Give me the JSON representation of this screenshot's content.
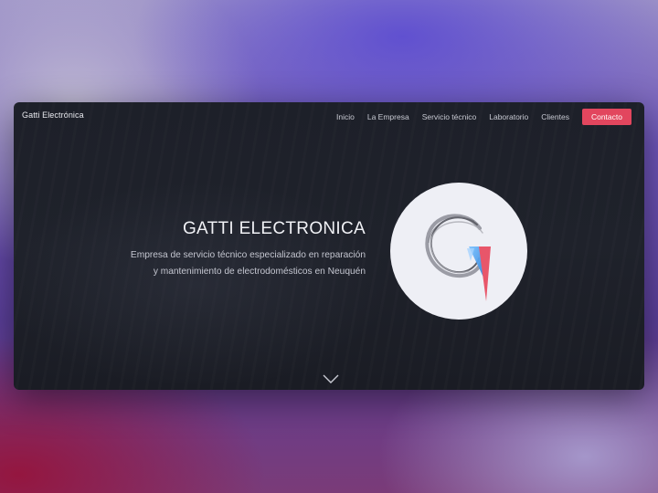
{
  "brand": "Gatti Electrónica",
  "nav": {
    "items": [
      "Inicio",
      "La Empresa",
      "Servicio técnico",
      "Laboratorio",
      "Clientes"
    ],
    "cta": "Contacto"
  },
  "hero": {
    "title": "GATTI ELECTRONICA",
    "subtitle": "Empresa de servicio técnico especializado en reparación y mantenimiento de electrodomésticos en Neuquén"
  },
  "icons": {
    "logo": "gatti-logo-icon",
    "scroll": "chevron-down-icon"
  },
  "colors": {
    "accent": "#e2465e",
    "window_bg": "#1e2129",
    "logo_blue": "#3a8fe0",
    "logo_red": "#e8566a"
  }
}
